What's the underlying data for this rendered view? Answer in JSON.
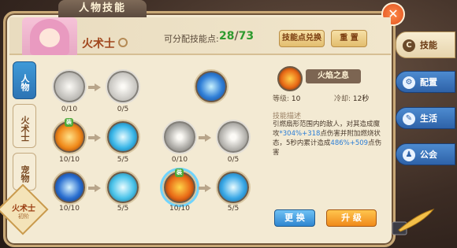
{
  "window": {
    "title": "人物技能",
    "close_symbol": "✕"
  },
  "header": {
    "class_name": "火术士",
    "points_label": "可分配技能点:",
    "points_current": "28",
    "points_sep": "/",
    "points_total": "73",
    "exchange_label": "技能点兑换",
    "reset_label": "重 置"
  },
  "side_tabs": [
    {
      "label": "人物",
      "active": true
    },
    {
      "label": "火术士",
      "active": false
    },
    {
      "label": "宠物",
      "active": false
    }
  ],
  "class_badge": {
    "label": "火术士",
    "sub": "初阶"
  },
  "tree": {
    "rows": [
      {
        "nodes": [
          {
            "level": "0/10",
            "icon": "claw-icon",
            "dim": true
          },
          {
            "level": "0/5",
            "icon": "arrow-burst-icon",
            "dim": true
          },
          {
            "level": "",
            "icon": "water-orb-icon",
            "dim": false
          }
        ]
      },
      {
        "nodes": [
          {
            "level": "10/10",
            "icon": "fire-burst-icon",
            "dim": false
          },
          {
            "level": "5/5",
            "icon": "crescent-icon",
            "dim": false
          },
          {
            "level": "0/10",
            "icon": "flame-pillar-icon",
            "dim": true
          },
          {
            "level": "0/5",
            "icon": "ring-icon",
            "dim": true
          }
        ]
      },
      {
        "nodes": [
          {
            "level": "10/10",
            "icon": "lightning-icon",
            "dim": false
          },
          {
            "level": "5/5",
            "icon": "wind-icon",
            "dim": false
          },
          {
            "level": "10/10",
            "icon": "flame-fan-icon",
            "dim": false,
            "selected": true
          },
          {
            "level": "5/5",
            "icon": "sphere-icon",
            "dim": false
          }
        ]
      }
    ]
  },
  "skill_detail": {
    "name": "火焰之息",
    "level_label": "等级:",
    "level_value": "10",
    "cooldown_label": "冷却:",
    "cooldown_value": "12秒",
    "desc_title": "技能描述",
    "desc_1": "引燃扇形范围内的敌人，对其造成魔攻",
    "desc_hl_1": "*304%+318",
    "desc_2": "点伤害并附加燃烧状态，5秒内累计造成",
    "desc_hl_2": "486%+509",
    "desc_3": "点伤害",
    "replace_label": "更 换",
    "upgrade_label": "升 级"
  },
  "right_menu": [
    {
      "label": "技能",
      "active": true,
      "icon": "skill-icon",
      "glyph": "C"
    },
    {
      "label": "配置",
      "active": false,
      "icon": "gear-icon",
      "glyph": "⚙"
    },
    {
      "label": "生活",
      "active": false,
      "icon": "chat-icon",
      "glyph": "✎"
    },
    {
      "label": "公会",
      "active": false,
      "icon": "guild-icon",
      "glyph": "♟"
    }
  ],
  "colors": {
    "accent_blue": "#2f86d0",
    "accent_orange": "#f08a1a",
    "points_green": "#2e9a2e",
    "highlight_blue": "#2a7dd6"
  }
}
